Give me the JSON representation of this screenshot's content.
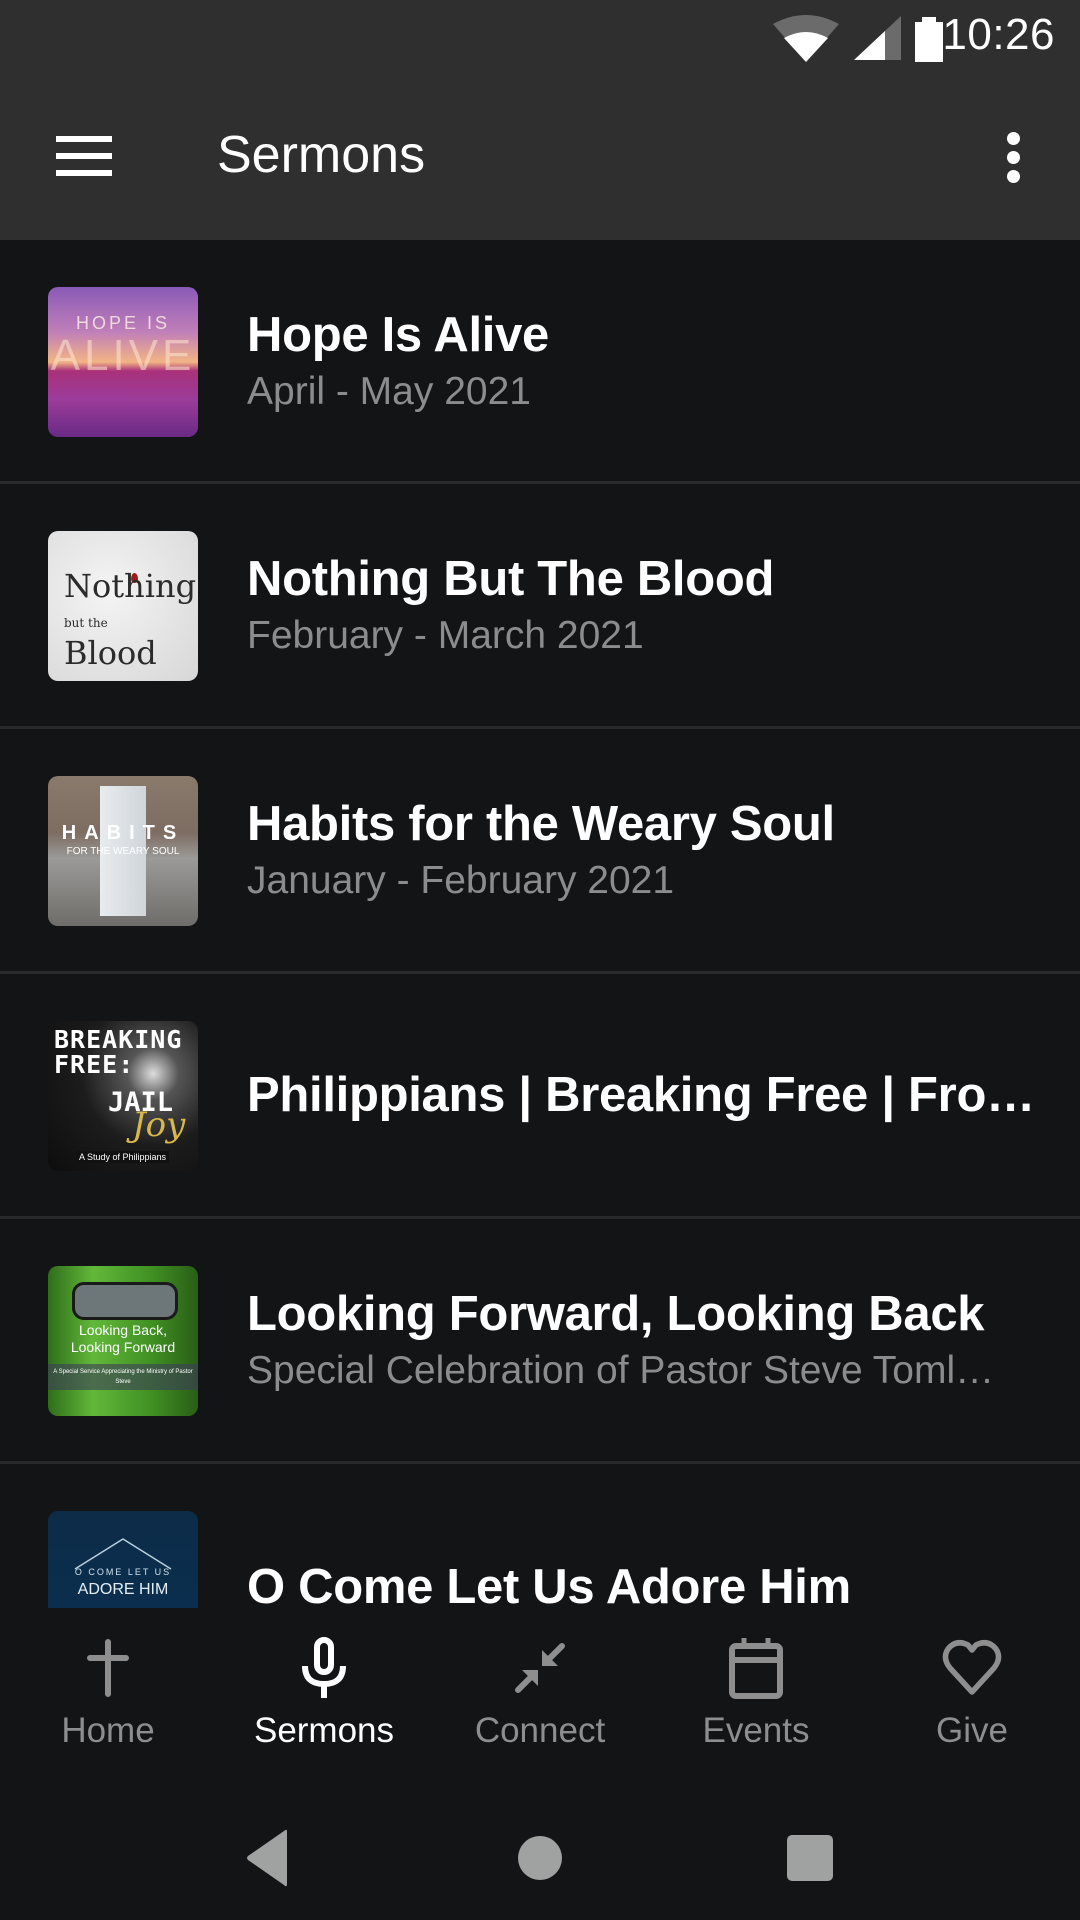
{
  "status_bar": {
    "time": "10:26",
    "icons": [
      "wifi-icon",
      "cell-signal-icon",
      "battery-icon"
    ]
  },
  "app_bar": {
    "title": "Sermons",
    "menu_icon": "hamburger-menu-icon",
    "overflow_icon": "more-vert-icon"
  },
  "sermons": [
    {
      "title": "Hope Is Alive",
      "subtitle": "April - May 2021",
      "artwork_text": [
        "HOPE IS",
        "ALIVE"
      ]
    },
    {
      "title": "Nothing But The Blood",
      "subtitle": "February - March 2021",
      "artwork_text": [
        "Nothing",
        "but the",
        "Blood"
      ]
    },
    {
      "title": "Habits for the Weary Soul",
      "subtitle": "January - February 2021",
      "artwork_text": [
        "HABITS",
        "FOR THE WEARY SOUL"
      ]
    },
    {
      "title": "Philippians | Breaking Free | Fro…",
      "subtitle": "",
      "artwork_text": [
        "BREAKING FREE:",
        "JAIL",
        "Joy",
        "A Study of Philippians"
      ]
    },
    {
      "title": "Looking Forward, Looking Back",
      "subtitle": "Special Celebration of Pastor Steve Toml…",
      "artwork_text": [
        "Looking Back, Looking Forward",
        "A Special Service Appreciating the Ministry of Pastor Steve"
      ]
    },
    {
      "title": "O Come Let Us Adore Him",
      "subtitle": "",
      "artwork_text": [
        "O COME LET US",
        "ADORE HIM"
      ]
    }
  ],
  "bottom_nav": {
    "items": [
      {
        "label": "Home",
        "icon": "cross-icon",
        "active": false
      },
      {
        "label": "Sermons",
        "icon": "microphone-icon",
        "active": true
      },
      {
        "label": "Connect",
        "icon": "connect-arrows-icon",
        "active": false
      },
      {
        "label": "Events",
        "icon": "calendar-icon",
        "active": false
      },
      {
        "label": "Give",
        "icon": "heart-icon",
        "active": false
      }
    ]
  },
  "system_nav": {
    "buttons": [
      "back",
      "home",
      "recents"
    ]
  },
  "colors": {
    "app_bar_bg": "#2f2f2f",
    "list_bg": "#131416",
    "divider": "#28292b",
    "subtitle": "#8c8c8c",
    "nav_inactive": "#8e8e8e",
    "nav_active": "#ffffff"
  }
}
